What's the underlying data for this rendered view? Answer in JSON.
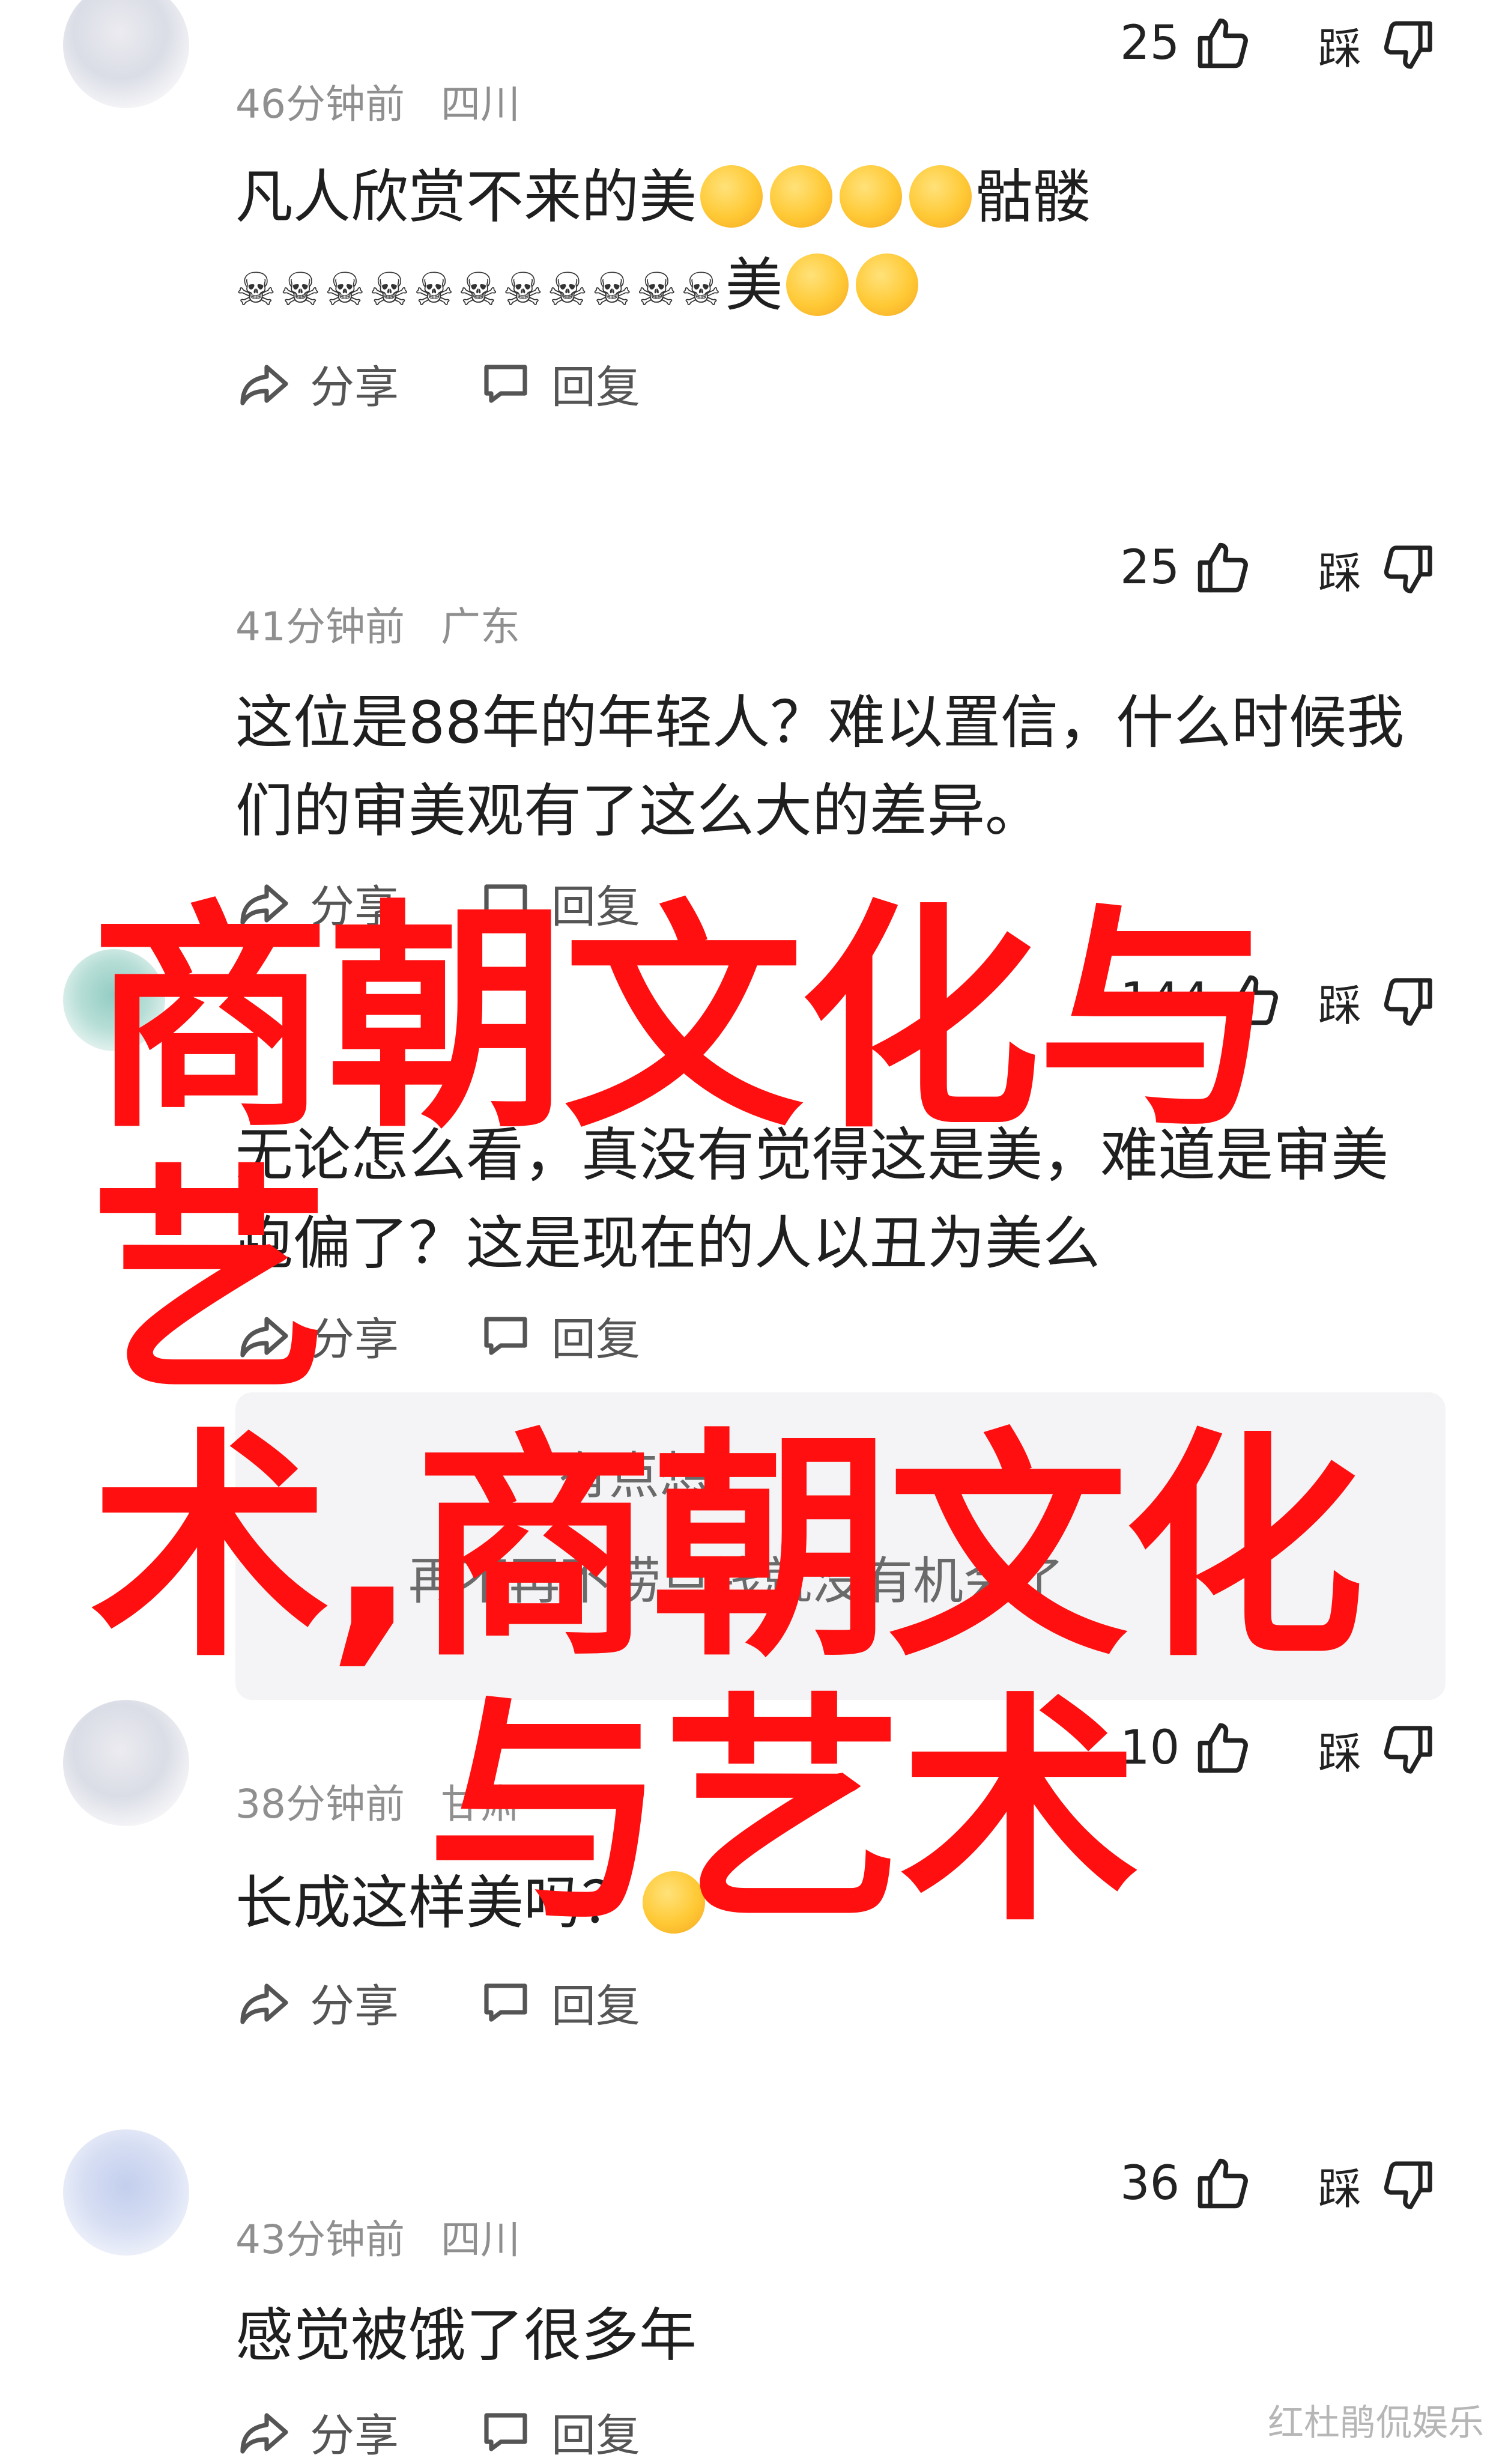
{
  "comments": [
    {
      "avatar_style": "default",
      "username": "",
      "time": "46分钟前",
      "location": "四川",
      "likes": "25",
      "dislike_label": "踩",
      "text_line1": "凡人欣赏不来的美",
      "text_line1_tail": "骷髅",
      "text_line2_skulls": "☠☠☠☠☠☠☠☠☠☠☠",
      "text_line2_tail": "美",
      "share_label": "分享",
      "reply_label": "回复"
    },
    {
      "avatar_style": "default",
      "username": "",
      "time": "41分钟前",
      "location": "广东",
      "likes": "25",
      "dislike_label": "踩",
      "text_line1": "这位是88年的年轻人？难以置信，什么时候我",
      "text_line2": "们的审美观有了这么大的差异。",
      "share_label": "分享",
      "reply_label": "回复"
    },
    {
      "avatar_style": "teal",
      "username": "",
      "time": "",
      "location": "",
      "likes": "144",
      "dislike_label": "踩",
      "text_line1": "无论怎么看，真没有觉得这是美，难道是审美",
      "text_line2": "跑偏了？这是现在的人以丑为美么",
      "share_label": "分享",
      "reply_label": "回复",
      "reply_preview_1": "有点想",
      "reply_preview_2": "再不再不捞点钱就没有机会了"
    },
    {
      "avatar_style": "default",
      "username": "",
      "time": "38分钟前",
      "location": "甘肃",
      "likes": "10",
      "dislike_label": "踩",
      "text_line1": "长成这样美吗？",
      "share_label": "分享",
      "reply_label": "回复"
    },
    {
      "avatar_style": "blue",
      "username": "",
      "time": "43分钟前",
      "location": "四川",
      "likes": "36",
      "dislike_label": "踩",
      "text_line1": "感觉被饿了很多年",
      "share_label": "分享",
      "reply_label": "回复"
    }
  ],
  "overlay": {
    "line1": "商朝文化与艺",
    "line2": "术,商朝文化",
    "line3": "与艺术",
    "color": "#ff0f0f"
  },
  "watermark": "红杜鹃侃娱乐",
  "icons": [
    "thumbs-up-icon",
    "thumbs-down-icon",
    "share-icon",
    "comment-icon"
  ]
}
